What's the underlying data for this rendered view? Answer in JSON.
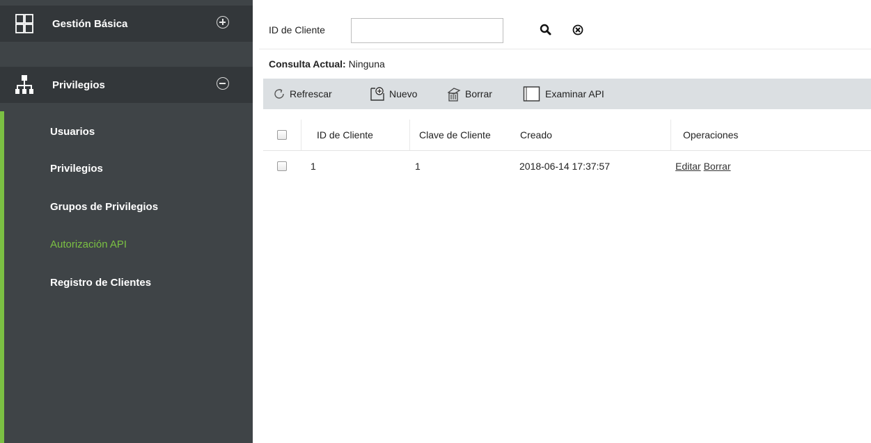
{
  "sidebar": {
    "modules": [
      {
        "label": "Gestión Básica",
        "icon": "grid-icon",
        "toggle": "expand"
      },
      {
        "label": "Privilegios",
        "icon": "hierarchy-icon",
        "toggle": "collapse"
      }
    ],
    "items": [
      {
        "label": "Usuarios"
      },
      {
        "label": "Privilegios"
      },
      {
        "label": "Grupos de Privilegios"
      },
      {
        "label": "Autorización API",
        "active": true
      },
      {
        "label": "Registro de Clientes"
      }
    ],
    "colors": {
      "accent": "#7bc043",
      "background": "#3f4447",
      "module_background": "#33373a"
    }
  },
  "search": {
    "label": "ID de Cliente",
    "value": "",
    "placeholder": ""
  },
  "query": {
    "label": "Consulta Actual:",
    "value": "Ninguna"
  },
  "toolbar": {
    "refresh_label": "Refrescar",
    "new_label": "Nuevo",
    "delete_label": "Borrar",
    "browse_api_label": "Examinar API"
  },
  "table": {
    "columns": [
      "ID de Cliente",
      "Clave de Cliente",
      "Creado",
      "Operaciones"
    ],
    "rows": [
      {
        "id": "1",
        "key": "1",
        "created": "2018-06-14 17:37:57",
        "ops": [
          "Editar",
          "Borrar"
        ]
      }
    ]
  }
}
